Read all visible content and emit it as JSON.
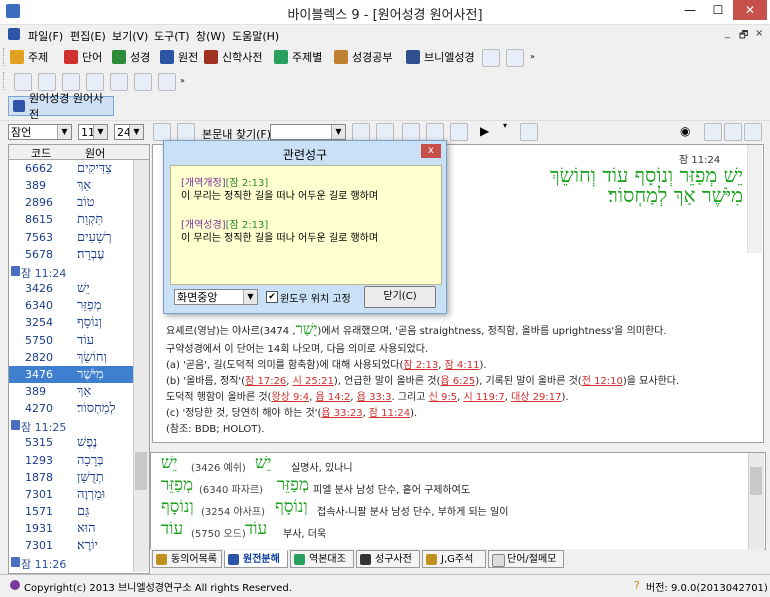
{
  "window": {
    "title": "바이블렉스 9 - [원어성경 원어사전]",
    "min_glyph": "—",
    "max_glyph": "☐",
    "close_glyph": "✕"
  },
  "menu": {
    "items": [
      "파일(F)",
      "편집(E)",
      "보기(V)",
      "도구(T)",
      "창(W)",
      "도움말(H)"
    ],
    "mdi": [
      "_",
      "🗗",
      "×"
    ]
  },
  "toolbar1": {
    "buttons": [
      "주제",
      "단어",
      "성경",
      "원전",
      "신학사전",
      "주제별",
      "성경공부",
      "브니엘성경"
    ]
  },
  "active_tab": {
    "label": "원어성경 원어사전"
  },
  "search_row": {
    "book": "잠언",
    "chapter": "11",
    "verse": "24",
    "find_label": "본문내 찾기(F):",
    "find_value": ""
  },
  "left_list": {
    "headers": [
      "코드",
      "원어"
    ],
    "rows": [
      {
        "type": "word",
        "code": "6662",
        "heb": "צַדִּיקִים"
      },
      {
        "type": "word",
        "code": "389",
        "heb": "אַךְ"
      },
      {
        "type": "word",
        "code": "2896",
        "heb": "טוֹב"
      },
      {
        "type": "word",
        "code": "8615",
        "heb": "תִּקְוַת"
      },
      {
        "type": "word",
        "code": "7563",
        "heb": "רְשָׁעִים"
      },
      {
        "type": "word",
        "code": "5678",
        "heb": "עֶבְרָה׃"
      },
      {
        "type": "ref",
        "ref": "잠 11:24"
      },
      {
        "type": "word",
        "code": "3426",
        "heb": "יֵשׁ"
      },
      {
        "type": "word",
        "code": "6340",
        "heb": "מְפַזֵּר"
      },
      {
        "type": "word",
        "code": "3254",
        "heb": "וְנוֹסָף"
      },
      {
        "type": "word",
        "code": "5750",
        "heb": "עוֹד"
      },
      {
        "type": "word",
        "code": "2820",
        "heb": "וְחוֹשֵׂךְ"
      },
      {
        "type": "word",
        "code": "3476",
        "heb": "מִיֹּשֶׁר",
        "selected": true
      },
      {
        "type": "word",
        "code": "389",
        "heb": "אַךְ"
      },
      {
        "type": "word",
        "code": "4270",
        "heb": "לְמַחְסוֹר׃"
      },
      {
        "type": "ref",
        "ref": "잠 11:25"
      },
      {
        "type": "word",
        "code": "5315",
        "heb": "נֶפֶשׁ"
      },
      {
        "type": "word",
        "code": "1293",
        "heb": "בְּרָכָה"
      },
      {
        "type": "word",
        "code": "1878",
        "heb": "תְדֻשָּׁן"
      },
      {
        "type": "word",
        "code": "7301",
        "heb": "וּמַרְוֶה"
      },
      {
        "type": "word",
        "code": "1571",
        "heb": "גַּם"
      },
      {
        "type": "word",
        "code": "1931",
        "heb": "הוּא"
      },
      {
        "type": "word",
        "code": "7301",
        "heb": "יוֹרֶא׃"
      },
      {
        "type": "ref",
        "ref": "잠 11:26"
      }
    ]
  },
  "verse": {
    "ref": "잠 11:24",
    "line1": "יֵשׁ מְפַזֵּר וְנוֹסָף עוֹד וְחוֹשֵׂךְ",
    "line2": "מִיֹּשֶׁר אַךְ לְמַחְסוֹר׃"
  },
  "definition": {
    "l1_a": "요셰르(영남)는 야사르(",
    "l1_heb": "יָשַׁר",
    "l1_b": ", 3474)에서 유래했으며, '곧음 straightness, 정직함, 올바름 uprightness'을 의미한다.",
    "l2": "구약성경에서 이 단어는 14회 나오며, 다음 의미로 사용되었다.",
    "l3_a": "(a)  '곧음', 길(도덕적 의미를 함축함)에 대해 사용되었다(",
    "l3_r1": "잠 2:13",
    "l3_sep": ", ",
    "l3_r2": "잠 4:11",
    "l3_b": ").",
    "l4_a": "(b)  '올바름, 정직'(",
    "l4_r1": "잠 17:26",
    "l4_r2": "시 25:21",
    "l4_b": "), 언급한 말이 올바른 것(",
    "l4_r3": "욥 6:25",
    "l4_c": "), 기록된 말이 올바른 것(",
    "l4_r4": "전 12:10",
    "l4_d": ")을 묘사한다.",
    "l5_a": "도덕적 행함이 올바른 것(",
    "l5_r1": "왕상 9:4",
    "l5_r2": "욥 14:2",
    "l5_r3": "욥 33:3",
    "l5_b": ". 그리고 ",
    "l5_r4": "신 9:5",
    "l5_r5": "시 119:7",
    "l5_r6": "대상 29:17",
    "l5_c": ").",
    "l6_a": "(c)  '정당한 것, 당연히 해야 하는 것'(",
    "l6_r1": "욥 33:23",
    "l6_r2": "잠 11:24",
    "l6_b": ").",
    "l7": "(참조: BDB; HOLOT)."
  },
  "popup": {
    "title": "관련성구",
    "close": "x",
    "entry1_ver": "[개역개정]",
    "entry1_ref": "[잠 2:13]",
    "entry1_text": "이 무리는 정직한 길을 떠나 어두운 길로 행하며",
    "entry2_ver": "[개역성경]",
    "entry2_ref": "[잠 2:13]",
    "entry2_text": "이 무리는 정직한 길을 떠나 어두운 길로 행하며",
    "position_select": "화면중앙",
    "fix_label": "윈도우 위치 고정",
    "fix_checked": true,
    "close_button": "닫기(C)"
  },
  "word_list": [
    {
      "h1": "יֵשׁ",
      "code": "(3426 예쉬)",
      "h2": "יֵשׁ",
      "meaning": "실명사, 있나니"
    },
    {
      "h1": "מְפַזֵּר",
      "code": "(6340 파자르)",
      "h2": "מְפַזֵּר",
      "meaning": "피엘 분사 남성 단수, 흩어 구제하여도"
    },
    {
      "h1": "וְנוֹסָף",
      "code": "(3254 야사프)",
      "h2": "וְנוֹסָף",
      "meaning": "접속사-니팔 분사 남성 단수, 부하게 되는 일이"
    },
    {
      "h1": "עוֹד",
      "code": "(5750 오드)",
      "h2": "עוֹד",
      "meaning": "부사, 더욱"
    }
  ],
  "bottom_tabs": [
    "동의어목록",
    "원전분해",
    "역본대조",
    "성구사전",
    "J,G주석",
    "단어/절메모"
  ],
  "status": {
    "copyright": "Copyright(c) 2013 브니엘성경연구소 All rights Reserved.",
    "version": "버전: 9.0.0(2013042701)"
  },
  "colors": {
    "accent": "#3f7fd0",
    "hebrew_green": "#18a018",
    "popup_bg": "#c9e0f6",
    "popup_inner": "#ffffcf",
    "close_red": "#c7504b"
  }
}
